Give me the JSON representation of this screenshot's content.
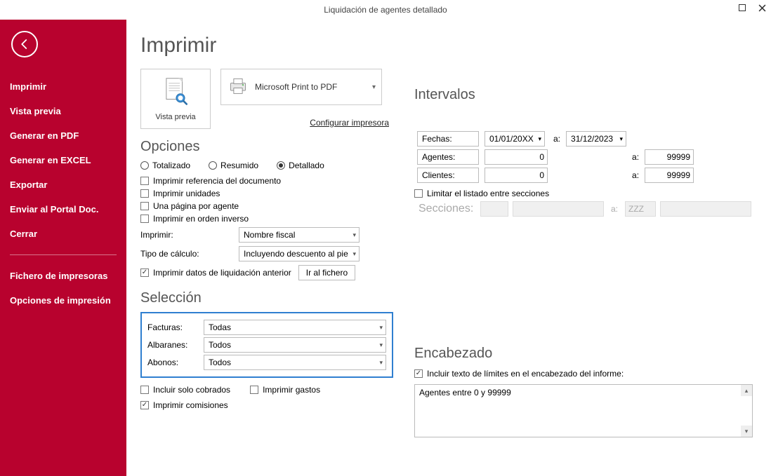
{
  "titlebar": {
    "title": "Liquidación de agentes detallado"
  },
  "sidebar": {
    "items": [
      {
        "label": "Imprimir"
      },
      {
        "label": "Vista previa"
      },
      {
        "label": "Generar en PDF"
      },
      {
        "label": "Generar en EXCEL"
      },
      {
        "label": "Exportar"
      },
      {
        "label": "Enviar al Portal Doc."
      },
      {
        "label": "Cerrar"
      }
    ],
    "items2": [
      {
        "label": "Fichero de impresoras"
      },
      {
        "label": "Opciones de impresión"
      }
    ]
  },
  "heading": "Imprimir",
  "preview_label": "Vista previa",
  "printer": {
    "name": "Microsoft Print to PDF",
    "config": "Configurar impresora"
  },
  "opciones": {
    "heading": "Opciones",
    "radio": {
      "totalizado": "Totalizado",
      "resumido": "Resumido",
      "detallado": "Detallado"
    },
    "chk_ref": "Imprimir referencia del documento",
    "chk_unid": "Imprimir unidades",
    "chk_pag": "Una página por agente",
    "chk_ord": "Imprimir en orden inverso",
    "imprimir_lbl": "Imprimir:",
    "imprimir_val": "Nombre fiscal",
    "tipo_lbl": "Tipo de cálculo:",
    "tipo_val": "Incluyendo descuento al pie",
    "chk_datos": "Imprimir datos de liquidación anterior",
    "btn_fichero": "Ir al fichero"
  },
  "seleccion": {
    "heading": "Selección",
    "facturas_lbl": "Facturas:",
    "facturas_val": "Todas",
    "albaranes_lbl": "Albaranes:",
    "albaranes_val": "Todos",
    "abonos_lbl": "Abonos:",
    "abonos_val": "Todos",
    "chk_cobrados": "Incluir solo cobrados",
    "chk_gastos": "Imprimir gastos",
    "chk_comisiones": "Imprimir comisiones"
  },
  "intervalos": {
    "heading": "Intervalos",
    "fechas_lbl": "Fechas:",
    "fecha_from": "01/01/20XX",
    "fecha_to": "31/12/2023",
    "a": "a:",
    "agentes_lbl": "Agentes:",
    "agentes_from": "0",
    "agentes_to": "99999",
    "clientes_lbl": "Clientes:",
    "clientes_from": "0",
    "clientes_to": "99999",
    "chk_limitar": "Limitar el listado entre secciones",
    "secciones_lbl": "Secciones:",
    "secciones_to": "ZZZ"
  },
  "encabezado": {
    "heading": "Encabezado",
    "chk_incluir": "Incluir texto de límites en el encabezado del informe:",
    "text": "Agentes entre 0 y 99999"
  }
}
